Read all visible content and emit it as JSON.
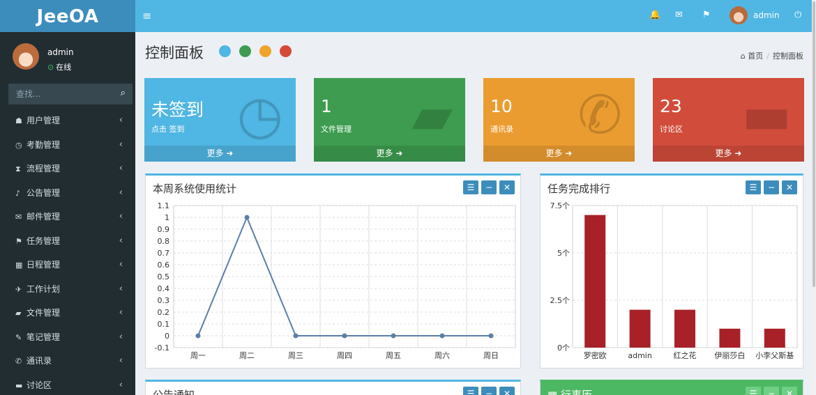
{
  "app": {
    "logo": "JeeOA"
  },
  "topbar": {
    "menu_icon": "≡",
    "bell": "🔔",
    "mail": "✉",
    "flag": "⚑",
    "username": "admin",
    "power": "⏻"
  },
  "user_panel": {
    "name": "admin",
    "status": "在线"
  },
  "search": {
    "placeholder": "查找..."
  },
  "sidebar": {
    "items": [
      {
        "label": "用户管理",
        "icon": "users-icon",
        "glyph": "☗"
      },
      {
        "label": "考勤管理",
        "icon": "clock-icon",
        "glyph": "◷"
      },
      {
        "label": "流程管理",
        "icon": "hourglass-icon",
        "glyph": "⧗"
      },
      {
        "label": "公告管理",
        "icon": "bell-icon",
        "glyph": "♪"
      },
      {
        "label": "邮件管理",
        "icon": "envelope-icon",
        "glyph": "✉"
      },
      {
        "label": "任务管理",
        "icon": "flag-icon",
        "glyph": "⚑"
      },
      {
        "label": "日程管理",
        "icon": "calendar-icon",
        "glyph": "▦"
      },
      {
        "label": "工作计划",
        "icon": "plane-icon",
        "glyph": "✈"
      },
      {
        "label": "文件管理",
        "icon": "folder-icon",
        "glyph": "▰"
      },
      {
        "label": "笔记管理",
        "icon": "edit-icon",
        "glyph": "✎"
      },
      {
        "label": "通讯录",
        "icon": "phone-icon",
        "glyph": "✆"
      },
      {
        "label": "讨论区",
        "icon": "comment-icon",
        "glyph": "▬"
      }
    ]
  },
  "page": {
    "title": "控制面板",
    "breadcrumb": {
      "home": "首页",
      "current": "控制面板"
    }
  },
  "theme_dots": [
    "#50b6e3",
    "#3d9c4f",
    "#f0a32f",
    "#d54a36"
  ],
  "stat_boxes": [
    {
      "value": "未签到",
      "label": "点击 签到",
      "more": "更多",
      "color": "#50b6e3",
      "icon": "clock-icon"
    },
    {
      "value": "1",
      "label": "文件管理",
      "more": "更多",
      "color": "#3d9c4f",
      "icon": "folder-open-icon"
    },
    {
      "value": "10",
      "label": "通讯录",
      "more": "更多",
      "color": "#eb9c30",
      "icon": "phone-icon"
    },
    {
      "value": "23",
      "label": "讨论区",
      "more": "更多",
      "color": "#d14c3b",
      "icon": "comment-icon"
    }
  ],
  "panels": {
    "weekly": {
      "title": "本周系统使用统计"
    },
    "tasks": {
      "title": "任务完成排行"
    },
    "notice": {
      "title": "公告通知"
    },
    "schedule": {
      "title": "行事历"
    }
  },
  "chart_data": [
    {
      "type": "line",
      "categories": [
        "周一",
        "周二",
        "周三",
        "周四",
        "周五",
        "周六",
        "周日"
      ],
      "values": [
        0,
        1,
        0,
        0,
        0,
        0,
        0
      ],
      "ylim": [
        -0.1,
        1.1
      ],
      "yticks": [
        "1.1",
        "1",
        "0.9",
        "0.8",
        "0.7",
        "0.6",
        "0.5",
        "0.4",
        "0.3",
        "0.2",
        "0.1",
        "0",
        "-0.1"
      ],
      "color": "#5a7fa8",
      "grid": true
    },
    {
      "type": "bar",
      "categories": [
        "罗密欧",
        "admin",
        "红之花",
        "伊丽莎白",
        "小李父斯基"
      ],
      "values": [
        7,
        2,
        2,
        1,
        1
      ],
      "ylim": [
        0,
        7.5
      ],
      "yticks": [
        "7.5个",
        "5个",
        "2.5个",
        "0个"
      ],
      "color": "#a82128",
      "grid": true
    }
  ]
}
